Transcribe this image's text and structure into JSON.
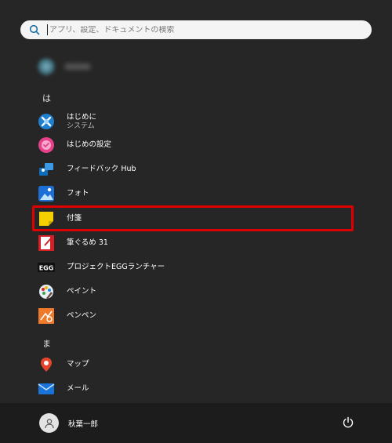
{
  "search": {
    "placeholder": "アプリ、設定、ドキュメントの検索"
  },
  "sections": [
    {
      "letter": "は"
    },
    {
      "letter": "ま"
    }
  ],
  "apps": [
    {
      "name": "はじめに",
      "sub": "システム",
      "icon": "tips-icon"
    },
    {
      "name": "はじめの設定",
      "icon": "first-setup-icon"
    },
    {
      "name": "フィードバック Hub",
      "icon": "feedback-hub-icon"
    },
    {
      "name": "フォト",
      "icon": "photos-icon"
    },
    {
      "name": "付箋",
      "icon": "sticky-notes-icon"
    },
    {
      "name": "筆ぐるめ 31",
      "icon": "fudegurume-icon"
    },
    {
      "name": "プロジェクトEGGランチャー",
      "icon": "egg-launcher-icon"
    },
    {
      "name": "ペイント",
      "icon": "paint-icon"
    },
    {
      "name": "ペンペン",
      "icon": "penpen-icon"
    },
    {
      "name": "マップ",
      "icon": "maps-icon"
    },
    {
      "name": "メール",
      "icon": "mail-icon"
    }
  ],
  "egg_icon_text": "EGG",
  "user": {
    "name": "秋葉一郎"
  },
  "colors": {
    "highlight": "#e00000",
    "background": "#262626",
    "footer": "#1c1c1c"
  }
}
